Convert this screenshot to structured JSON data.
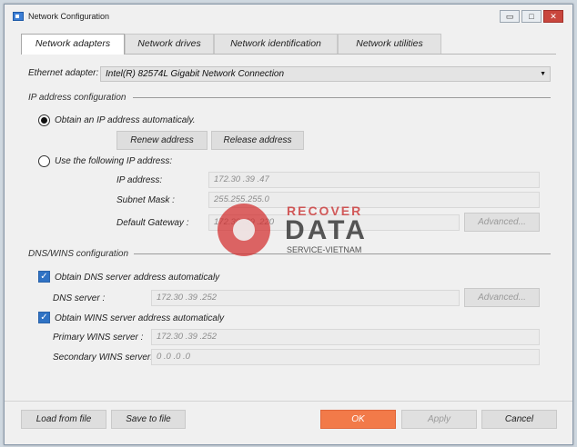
{
  "window": {
    "title": "Network Configuration",
    "controls": {
      "minimize": "▭",
      "maximize": "□",
      "close": "✕"
    }
  },
  "tabs": [
    {
      "label": "Network adapters",
      "active": true
    },
    {
      "label": "Network drives",
      "active": false
    },
    {
      "label": "Network identification",
      "active": false
    },
    {
      "label": "Network utilities",
      "active": false
    }
  ],
  "adapter": {
    "label": "Ethernet adapter:",
    "value": "Intel(R) 82574L Gigabit Network Connection"
  },
  "ip_section": {
    "title": "IP address configuration",
    "auto_option": {
      "label": "Obtain an IP address automaticaly.",
      "checked": true
    },
    "renew_button": "Renew address",
    "release_button": "Release address",
    "manual_option": {
      "label": "Use the following IP address:",
      "checked": false
    },
    "ip_address": {
      "label": "IP address:",
      "value": "172.30 .39 .47"
    },
    "subnet_mask": {
      "label": "Subnet Mask :",
      "value": "255.255.255.0"
    },
    "gateway": {
      "label": "Default Gateway :",
      "value": "172.30 .39 .220"
    },
    "advanced_button": "Advanced..."
  },
  "dns_section": {
    "title": "DNS/WINS configuration",
    "dns_auto": {
      "label": "Obtain DNS server address automaticaly",
      "checked": true
    },
    "dns_server": {
      "label": "DNS server :",
      "value": "172.30 .39 .252"
    },
    "advanced_button": "Advanced...",
    "wins_auto": {
      "label": "Obtain WINS server address automaticaly",
      "checked": true
    },
    "primary_wins": {
      "label": "Primary WINS server :",
      "value": "172.30 .39 .252"
    },
    "secondary_wins": {
      "label": "Secondary WINS server:",
      "value": "0 .0 .0 .0"
    }
  },
  "footer": {
    "load_button": "Load from file",
    "save_button": "Save to file",
    "ok_button": "OK",
    "apply_button": "Apply",
    "cancel_button": "Cancel"
  },
  "watermark": {
    "line1": "RECOVER",
    "line2": "DATA",
    "line3": "SERVICE-VIETNAM"
  },
  "colors": {
    "accent_ok": "#f27a49",
    "checkbox_blue": "#2f72c4",
    "close_red": "#c9463d"
  }
}
